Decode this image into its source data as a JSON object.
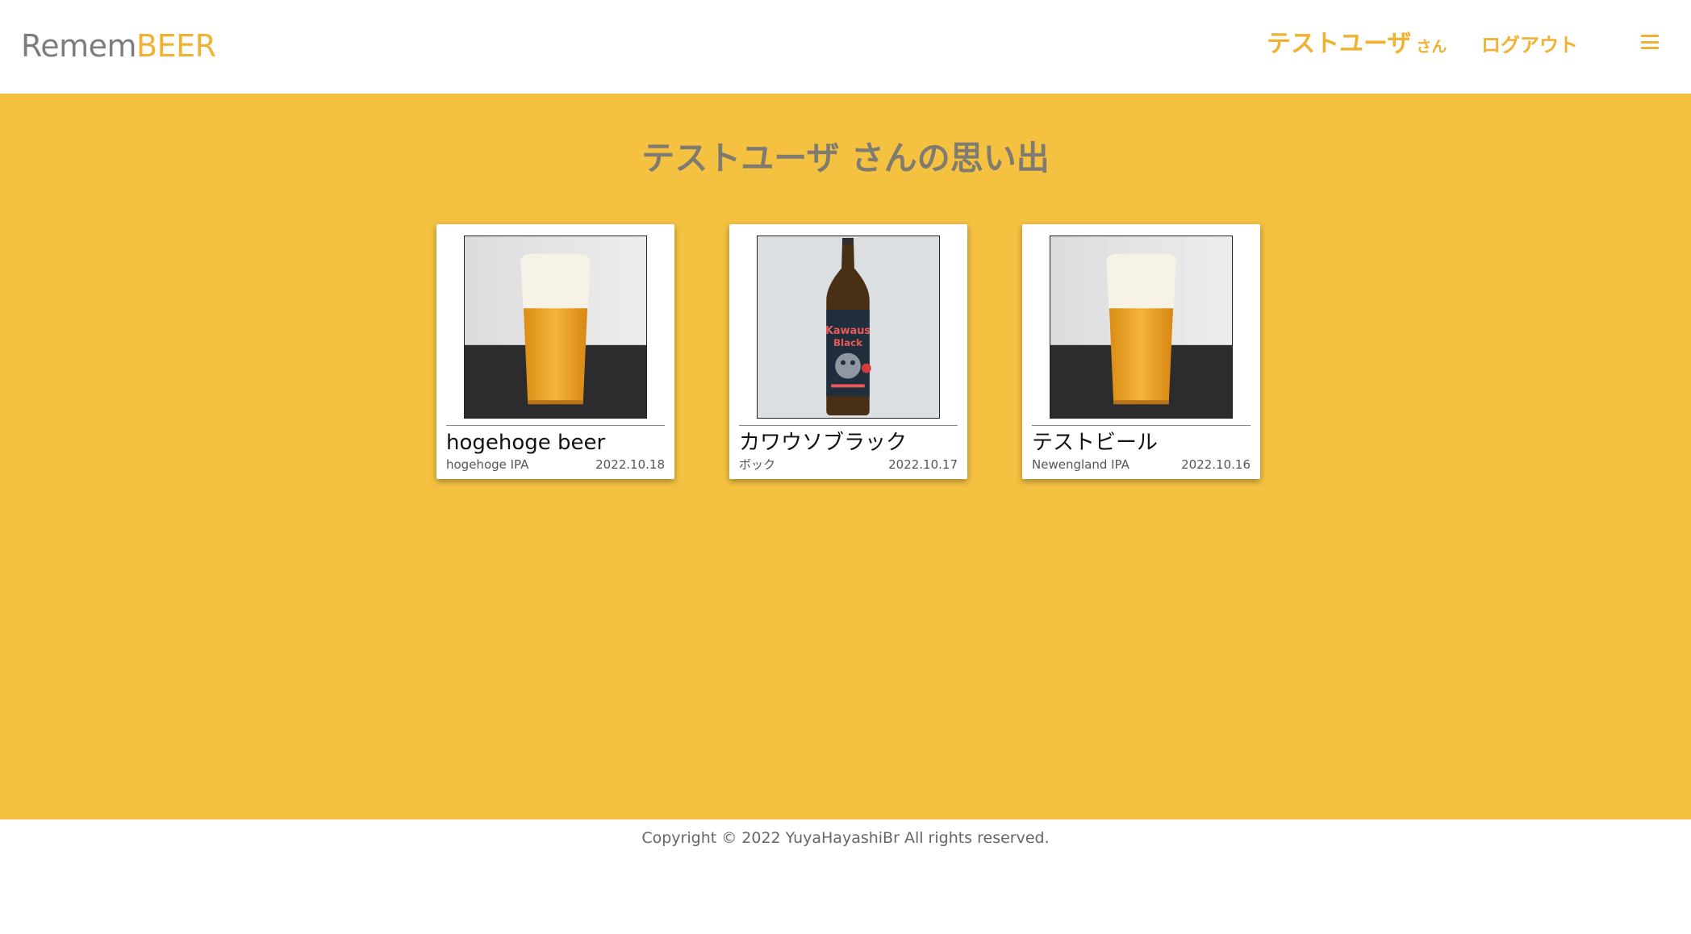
{
  "header": {
    "logo_part1": "Remem",
    "logo_part2": "BEER",
    "user_name": "テストユーザ",
    "user_suffix": "さん",
    "logout_label": "ログアウト",
    "menu_icon": "hamburger-menu-icon"
  },
  "main": {
    "title": "テストユーザ さんの思い出",
    "cards": [
      {
        "name": "hogehoge beer",
        "style": "hogehoge IPA",
        "date": "2022.10.18",
        "photo": "beer-glass"
      },
      {
        "name": "カワウソブラック",
        "style": "ボック",
        "date": "2022.10.17",
        "photo": "beer-bottle"
      },
      {
        "name": "テストビール",
        "style": "Newengland IPA",
        "date": "2022.10.16",
        "photo": "beer-glass"
      }
    ]
  },
  "footer": {
    "copyright": "Copyright © 2022 YuyaHayashiBr All rights reserved."
  },
  "colors": {
    "accent": "#f0b232",
    "background": "#f4c141",
    "title": "#7f7b71"
  }
}
